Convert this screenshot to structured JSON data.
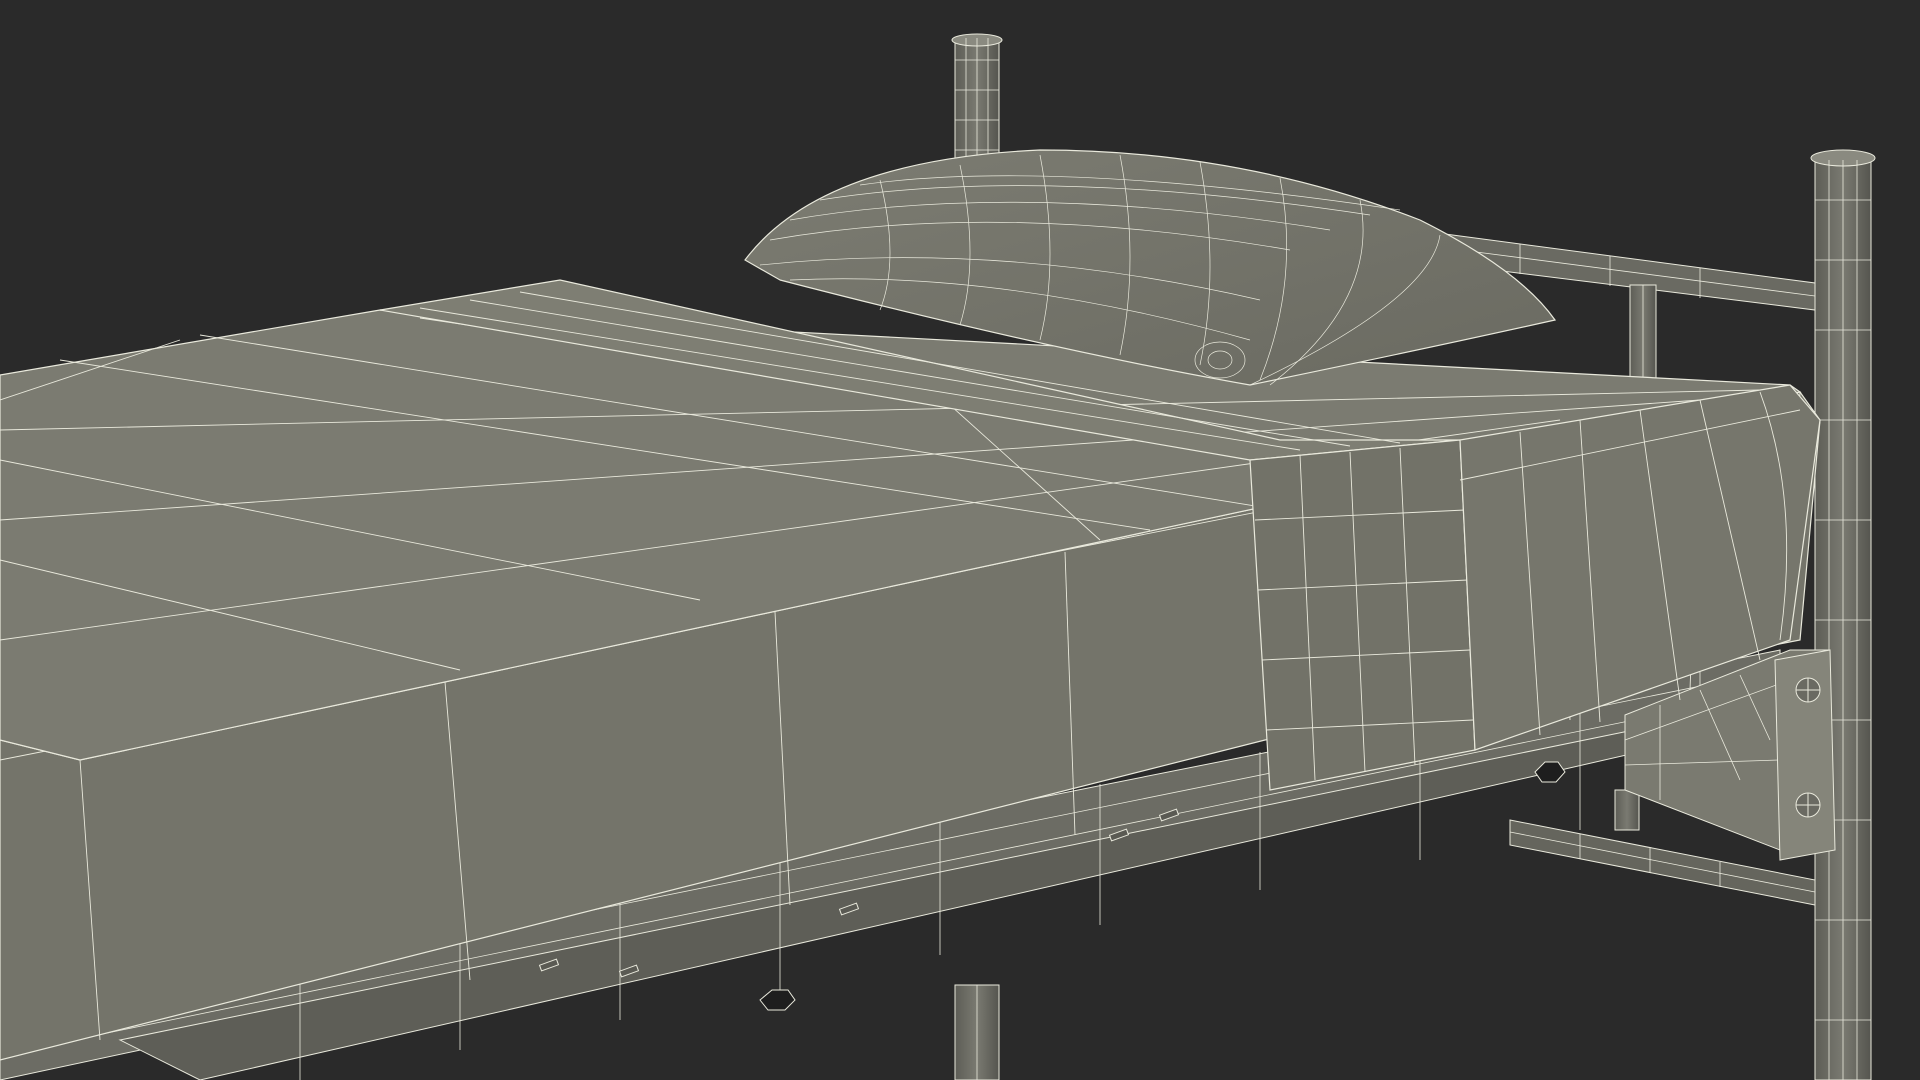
{
  "scene": {
    "subject": "bed-wireframe-render",
    "colors": {
      "background": "#2a2a2a",
      "surface": "#74746a",
      "surface_light": "#7e7e73",
      "surface_dark": "#66665d",
      "metal": "#6e6e66",
      "metal_dark": "#5a5a53",
      "wire": "#e9e9dc"
    }
  }
}
